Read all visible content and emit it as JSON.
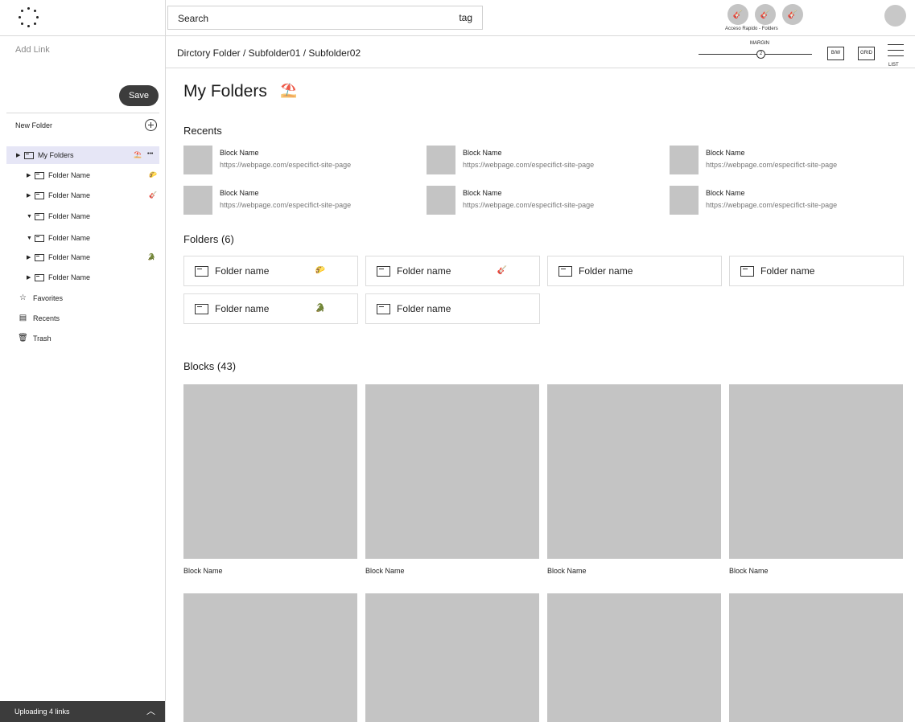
{
  "topbar": {
    "search_placeholder": "Search",
    "tag_label": "tag",
    "quick_access_label": "Acceso Rapido - Folders"
  },
  "sidebar": {
    "add_link": "Add Link",
    "save_label": "Save",
    "new_folder_label": "New Folder",
    "tree": [
      {
        "label": "My Folders",
        "expanded": false,
        "emoji": "⛱️",
        "more": "•••"
      },
      {
        "label": "Folder Name",
        "expanded": false,
        "emoji": "🌮"
      },
      {
        "label": "Folder Name",
        "expanded": false,
        "emoji": "🎸"
      },
      {
        "label": "Folder Name",
        "expanded": true,
        "emoji": ""
      },
      {
        "label": "Folder Name",
        "expanded": true,
        "emoji": ""
      },
      {
        "label": "Folder Name",
        "expanded": false,
        "emoji": "🐊"
      },
      {
        "label": "Folder Name",
        "expanded": false,
        "emoji": ""
      }
    ],
    "nav": [
      {
        "label": "Favorites",
        "icon": "star-icon"
      },
      {
        "label": "Recents",
        "icon": "recents-icon"
      },
      {
        "label": "Trash",
        "icon": "trash-icon"
      }
    ],
    "uploading_label": "Uploading 4 links"
  },
  "header": {
    "breadcrumb": "Dirctory Folder / Subfolder01 / Subfolder02",
    "margin_label": "MARGIN",
    "margin_value": "2",
    "bw_label": "B/W",
    "grid_label": "GRID",
    "list_label": "LIST"
  },
  "main": {
    "title": "My Folders",
    "title_emoji": "⛱️",
    "recents_title": "Recents",
    "recents": [
      {
        "name": "Block Name",
        "url": "https://webpage.com/especifict-site-page"
      },
      {
        "name": "Block Name",
        "url": "https://webpage.com/especifict-site-page"
      },
      {
        "name": "Block Name",
        "url": "https://webpage.com/especifict-site-page"
      },
      {
        "name": "Block Name",
        "url": "https://webpage.com/especifict-site-page"
      },
      {
        "name": "Block Name",
        "url": "https://webpage.com/especifict-site-page"
      },
      {
        "name": "Block Name",
        "url": "https://webpage.com/especifict-site-page"
      }
    ],
    "folders_title": "Folders (6)",
    "folders": [
      {
        "name": "Folder name",
        "emoji": "🌮"
      },
      {
        "name": "Folder name",
        "emoji": "🎸"
      },
      {
        "name": "Folder name",
        "emoji": ""
      },
      {
        "name": "Folder name",
        "emoji": ""
      },
      {
        "name": "Folder name",
        "emoji": "🐊"
      },
      {
        "name": "Folder name",
        "emoji": ""
      }
    ],
    "blocks_title": "Blocks (43)",
    "blocks": [
      {
        "name": "Block Name"
      },
      {
        "name": "Block Name"
      },
      {
        "name": "Block Name"
      },
      {
        "name": "Block Name"
      },
      {
        "name": ""
      },
      {
        "name": ""
      },
      {
        "name": ""
      },
      {
        "name": ""
      }
    ]
  }
}
